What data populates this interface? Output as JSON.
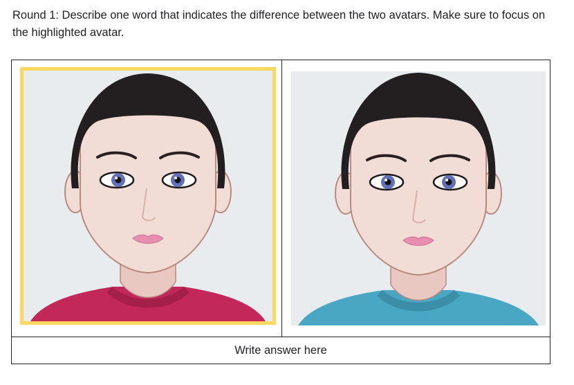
{
  "instructions": {
    "text": "Round 1: Describe one word that indicates the difference between the two avatars. Make sure to focus on the highlighted avatar."
  },
  "avatars": [
    {
      "highlighted": true,
      "shirt_color": "#c2285a",
      "shirt_collar_color": "#a51f4b",
      "highlight_color": "#ffd75c"
    },
    {
      "highlighted": false,
      "shirt_color": "#4aa7c3",
      "shirt_collar_color": "#3b8ea8"
    }
  ],
  "colors": {
    "background": "#e9ecee",
    "skin": "#f1dcd6",
    "hair": "#231f20",
    "lips": "#e88fb1",
    "iris": "#6170b8"
  },
  "answer": {
    "placeholder": "Write answer here"
  }
}
